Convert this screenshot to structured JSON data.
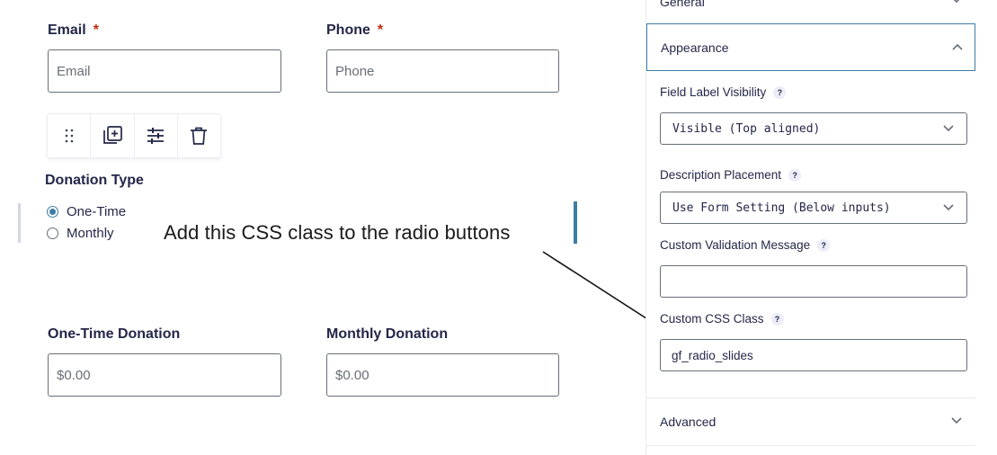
{
  "form": {
    "email": {
      "label": "Email",
      "required_mark": "*",
      "placeholder": "Email"
    },
    "phone": {
      "label": "Phone",
      "required_mark": "*",
      "placeholder": "Phone"
    },
    "toolbar": {
      "icons": [
        "drag-handle-icon",
        "duplicate-icon",
        "settings-sliders-icon",
        "trash-icon"
      ]
    },
    "donation_type": {
      "label": "Donation Type",
      "options": [
        {
          "label": "One-Time",
          "checked": true
        },
        {
          "label": "Monthly",
          "checked": false
        }
      ]
    },
    "one_time_donation": {
      "label": "One-Time Donation",
      "placeholder": "$0.00"
    },
    "monthly_donation": {
      "label": "Monthly Donation",
      "placeholder": "$0.00"
    }
  },
  "annotation": {
    "text": "Add this CSS class to the radio buttons"
  },
  "sidebar": {
    "general": {
      "title": "General"
    },
    "appearance": {
      "title": "Appearance",
      "field_label_visibility": {
        "label": "Field Label Visibility",
        "help": "?",
        "value": "Visible (Top aligned)"
      },
      "description_placement": {
        "label": "Description Placement",
        "help": "?",
        "value": "Use Form Setting (Below inputs)"
      },
      "custom_validation_message": {
        "label": "Custom Validation Message",
        "help": "?",
        "value": ""
      },
      "custom_css_class": {
        "label": "Custom CSS Class",
        "help": "?",
        "value": "gf_radio_slides"
      }
    },
    "advanced": {
      "title": "Advanced"
    }
  },
  "colors": {
    "accent": "#3e7da6",
    "required": "#c02b0a",
    "text": "#242748",
    "border": "#686e77"
  }
}
